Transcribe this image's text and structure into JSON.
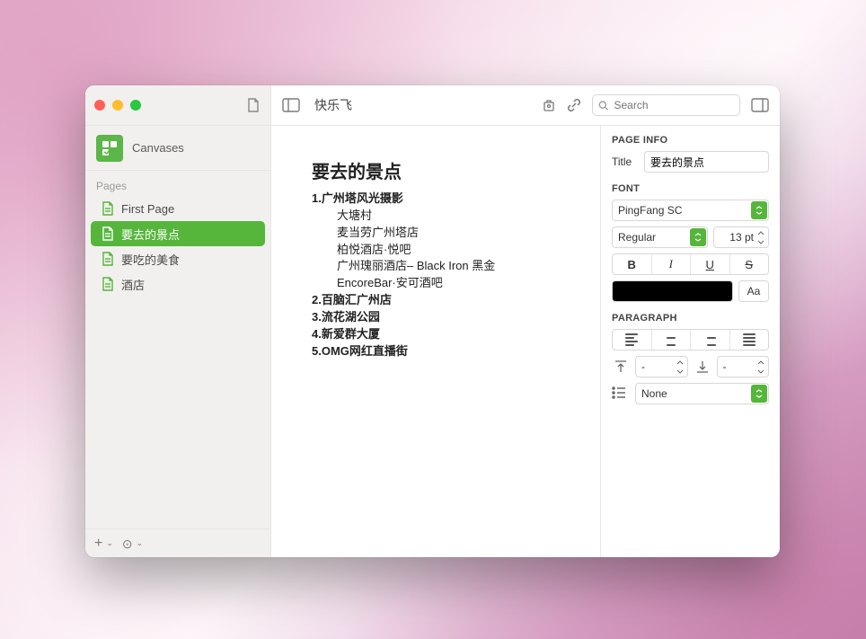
{
  "sidebar": {
    "canvases_label": "Canvases",
    "pages_header": "Pages",
    "pages": [
      {
        "label": "First Page",
        "selected": false
      },
      {
        "label": "要去的景点",
        "selected": true
      },
      {
        "label": "要吃的美食",
        "selected": false
      },
      {
        "label": "酒店",
        "selected": false
      }
    ]
  },
  "toolbar": {
    "title": "快乐飞",
    "search_placeholder": "Search"
  },
  "document": {
    "title": "要去的景点",
    "lines": [
      {
        "text": "1.广州塔风光摄影",
        "bold": true,
        "indent": 0
      },
      {
        "text": "大塘村",
        "bold": false,
        "indent": 1
      },
      {
        "text": "麦当劳广州塔店",
        "bold": false,
        "indent": 1
      },
      {
        "text": "柏悦酒店·悦吧",
        "bold": false,
        "indent": 1
      },
      {
        "text": "广州瑰丽酒店– Black Iron 黑金",
        "bold": false,
        "indent": 1
      },
      {
        "text": "EncoreBar·安可酒吧",
        "bold": false,
        "indent": 1
      },
      {
        "text": "2.百脑汇广州店",
        "bold": true,
        "indent": 0
      },
      {
        "text": "3.流花湖公园",
        "bold": true,
        "indent": 0
      },
      {
        "text": "4.新爱群大厦",
        "bold": true,
        "indent": 0
      },
      {
        "text": "5.OMG网红直播街",
        "bold": true,
        "indent": 0
      }
    ]
  },
  "inspector": {
    "page_info_label": "PAGE INFO",
    "title_label": "Title",
    "title_value": "要去的景点",
    "font_label": "FONT",
    "font_family": "PingFang SC",
    "font_style": "Regular",
    "font_size": "13 pt",
    "bold": "B",
    "italic": "I",
    "underline": "U",
    "strike": "S",
    "text_color": "#000000",
    "aa": "Aa",
    "paragraph_label": "PARAGRAPH",
    "spacing_before": "-",
    "spacing_after": "-",
    "list_style": "None"
  }
}
